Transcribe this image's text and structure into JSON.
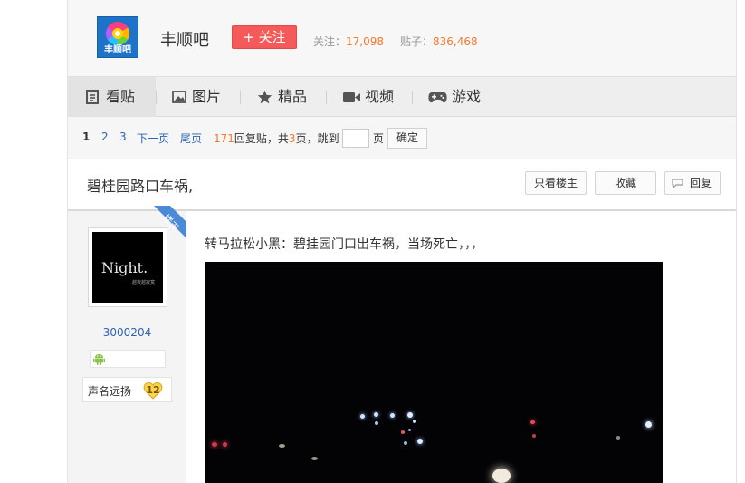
{
  "forum": {
    "logo_text": "丰顺吧",
    "name": "丰顺吧",
    "follow_label": "+ 关注",
    "followers_label": "关注：",
    "followers": "17,098",
    "posts_label": "贴子：",
    "posts": "836,468"
  },
  "nav": {
    "tabs": [
      {
        "label": "看贴",
        "icon": "document-icon"
      },
      {
        "label": "图片",
        "icon": "image-icon"
      },
      {
        "label": "精品",
        "icon": "star-icon"
      },
      {
        "label": "视频",
        "icon": "video-camera-icon"
      },
      {
        "label": "游戏",
        "icon": "gamepad-icon"
      }
    ]
  },
  "pager": {
    "current": "1",
    "page2": "2",
    "page3": "3",
    "next": "下一页",
    "last": "尾页",
    "reply_count": "171",
    "reply_text": "回复贴，共",
    "total_pages": "3",
    "pages_text": "页，跳到",
    "page_unit": "页",
    "confirm": "确定"
  },
  "thread": {
    "title": "碧桂园路口车祸,",
    "only_op": "只看楼主",
    "favorite": "收藏",
    "reply": "回复"
  },
  "post": {
    "op_badge": "楼主",
    "username": "3000204",
    "avatar_text": "Night.",
    "avatar_subtext": "越夜越寂寞",
    "level_name": "声名远扬",
    "level": "12",
    "content": "转马拉松小黑：碧挂园门口出车祸，当场死亡，，，"
  }
}
